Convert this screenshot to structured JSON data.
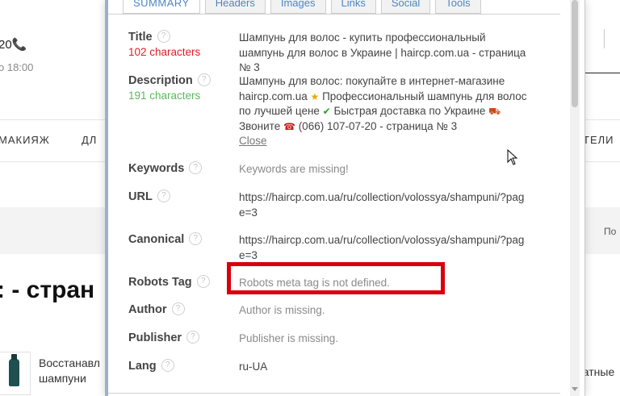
{
  "background": {
    "phone_digits": "20",
    "hours": "о 18:00",
    "nav_items": [
      "МАКИЯЖ",
      "ДЛ",
      "ТЕЛИ"
    ],
    "page_title": ": - стран",
    "pagination_label": "По",
    "product_name": "Восстанавл\nшампуни",
    "product_right": "ратные"
  },
  "tabs": [
    "SUMMARY",
    "Headers",
    "Images",
    "Links",
    "Social",
    "Tools"
  ],
  "summary": {
    "title": {
      "label": "Title",
      "count": "102 characters",
      "value": "Шампунь для волос - купить профессиональный шампунь для волос в Украине | haircp.com.ua - страница № 3"
    },
    "description": {
      "label": "Description",
      "count": "191 characters",
      "part1": "Шампунь для волос: покупайте в интернет-магазине haircp.com.ua ",
      "part2": " Профессиональный шампунь для волос по лучшей цене ",
      "part3": " Быстрая доставка по Украине ",
      "part4": " Звоните ",
      "part5": " (066) 107-07-20 - страница № 3",
      "close": "Close"
    },
    "keywords": {
      "label": "Keywords",
      "value": "Keywords are missing!"
    },
    "url": {
      "label": "URL",
      "value": "https://haircp.com.ua/ru/collection/volossya/shampuni/?page=3"
    },
    "canonical": {
      "label": "Canonical",
      "value": "https://haircp.com.ua/ru/collection/volossya/shampuni/?page=3"
    },
    "robots": {
      "label": "Robots Tag",
      "value": "Robots meta tag is not defined."
    },
    "author": {
      "label": "Author",
      "value": "Author is missing."
    },
    "publisher": {
      "label": "Publisher",
      "value": "Publisher is missing."
    },
    "lang": {
      "label": "Lang",
      "value": "ru-UA"
    }
  },
  "icons": {
    "help": "help-icon",
    "star": "star-icon",
    "check": "check-icon",
    "truck": "truck-icon",
    "phone": "phone-icon"
  },
  "colors": {
    "char_count_bad": "#e02020",
    "char_count_good": "#5cb85c",
    "highlight": "#d8000c",
    "tab_text": "#4a86c5"
  }
}
